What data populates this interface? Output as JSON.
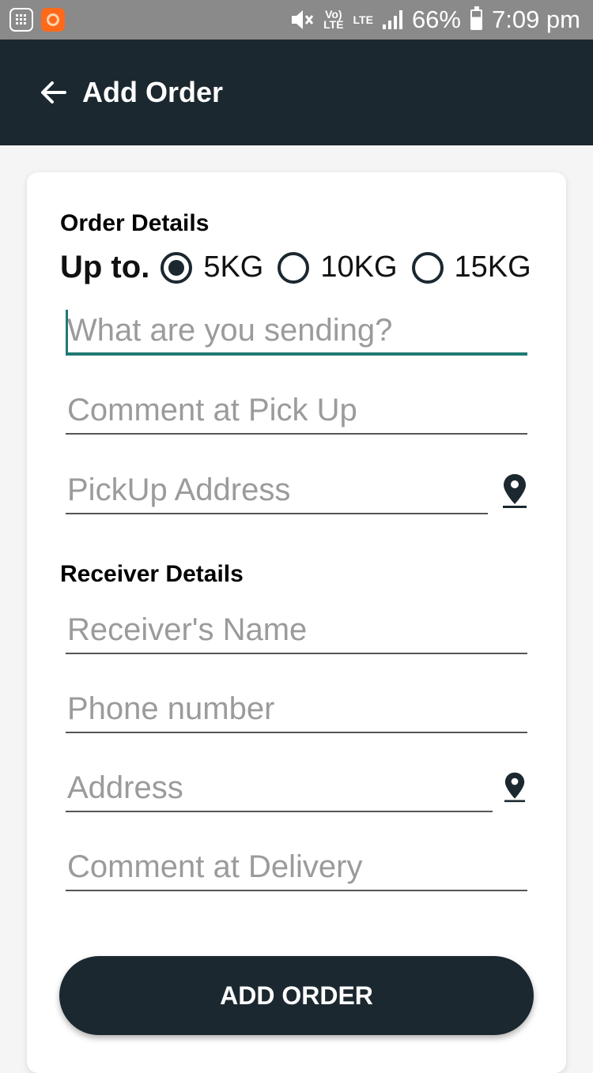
{
  "status_bar": {
    "volte": "Vo)\nLTE",
    "lte": "LTE",
    "battery": "66%",
    "time": "7:09 pm"
  },
  "app_bar": {
    "title": "Add Order"
  },
  "order_details": {
    "title": "Order Details",
    "weight_label": "Up to.",
    "weight_options": [
      "5KG",
      "10KG",
      "15KG"
    ],
    "selected_weight": "5KG",
    "what_sending_placeholder": "What are you sending?",
    "pickup_comment_placeholder": "Comment at Pick Up",
    "pickup_address_placeholder": "PickUp Address"
  },
  "receiver_details": {
    "title": "Receiver Details",
    "name_placeholder": "Receiver's Name",
    "phone_placeholder": "Phone number",
    "address_placeholder": "Address",
    "delivery_comment_placeholder": "Comment at Delivery"
  },
  "submit": {
    "label": "ADD ORDER"
  },
  "colors": {
    "primary": "#1c2830",
    "accent": "#1f7a72",
    "status_bar": "#8a8a8a"
  }
}
